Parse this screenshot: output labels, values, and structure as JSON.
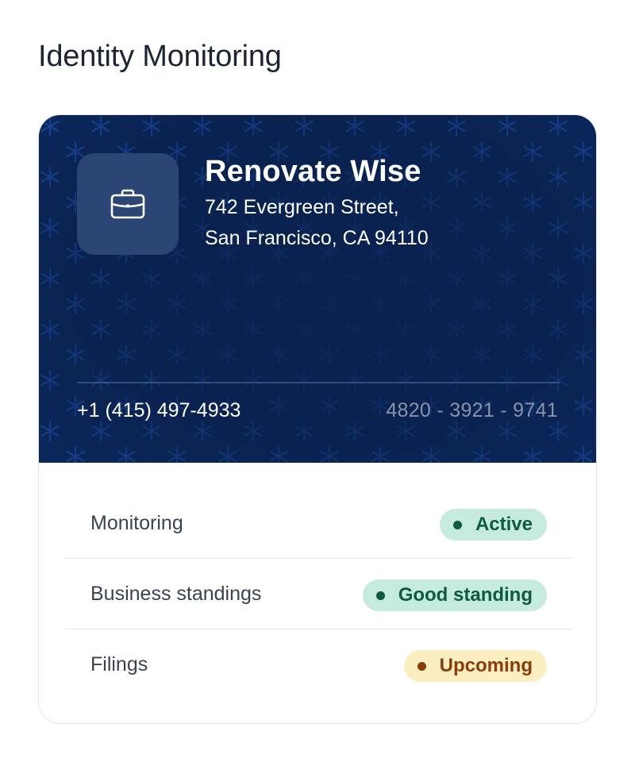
{
  "page": {
    "title": "Identity Monitoring"
  },
  "identity_card": {
    "icon": "briefcase-icon",
    "business_name": "Renovate Wise",
    "address_line1": "742 Evergreen Street,",
    "address_line2": "San Francisco, CA 94110",
    "phone": "+1 (415) 497-4933",
    "account_number": "4820 - 3921 - 9741",
    "background_color": "#092250",
    "tile_color": "#2b4674"
  },
  "status_rows": [
    {
      "label": "Monitoring",
      "badge": "Active",
      "tone": "success"
    },
    {
      "label": "Business standings",
      "badge": "Good standing",
      "tone": "success"
    },
    {
      "label": "Filings",
      "badge": "Upcoming",
      "tone": "warning"
    }
  ],
  "colors": {
    "success_bg": "#c5ebdc",
    "success_text": "#0f5b3e",
    "warning_bg": "#fbeec0",
    "warning_text": "#8a3d08"
  }
}
